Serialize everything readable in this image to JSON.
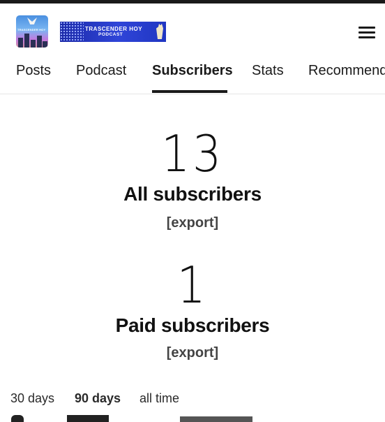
{
  "header": {
    "logo_mini_text": "TRASCENDER HOY",
    "banner_line1": "TRASCENDER HOY",
    "banner_line2": "PODCAST",
    "menu_icon": "hamburger-menu-icon"
  },
  "tabs": [
    {
      "label": "Posts"
    },
    {
      "label": "Podcast"
    },
    {
      "label": "Subscribers",
      "active": true
    },
    {
      "label": "Stats"
    },
    {
      "label": "Recommendations"
    }
  ],
  "all_subscribers": {
    "count": "13",
    "label": "All subscribers",
    "export_label": "[export]"
  },
  "paid_subscribers": {
    "count": "1",
    "label": "Paid subscribers",
    "export_label": "[export]"
  },
  "periods": [
    {
      "label": "30 days"
    },
    {
      "label": "90 days",
      "active": true
    },
    {
      "label": "all time"
    }
  ],
  "colors": {
    "text": "#111111",
    "banner_blue": "#2f45d8",
    "divider": "#e6e6e6"
  }
}
